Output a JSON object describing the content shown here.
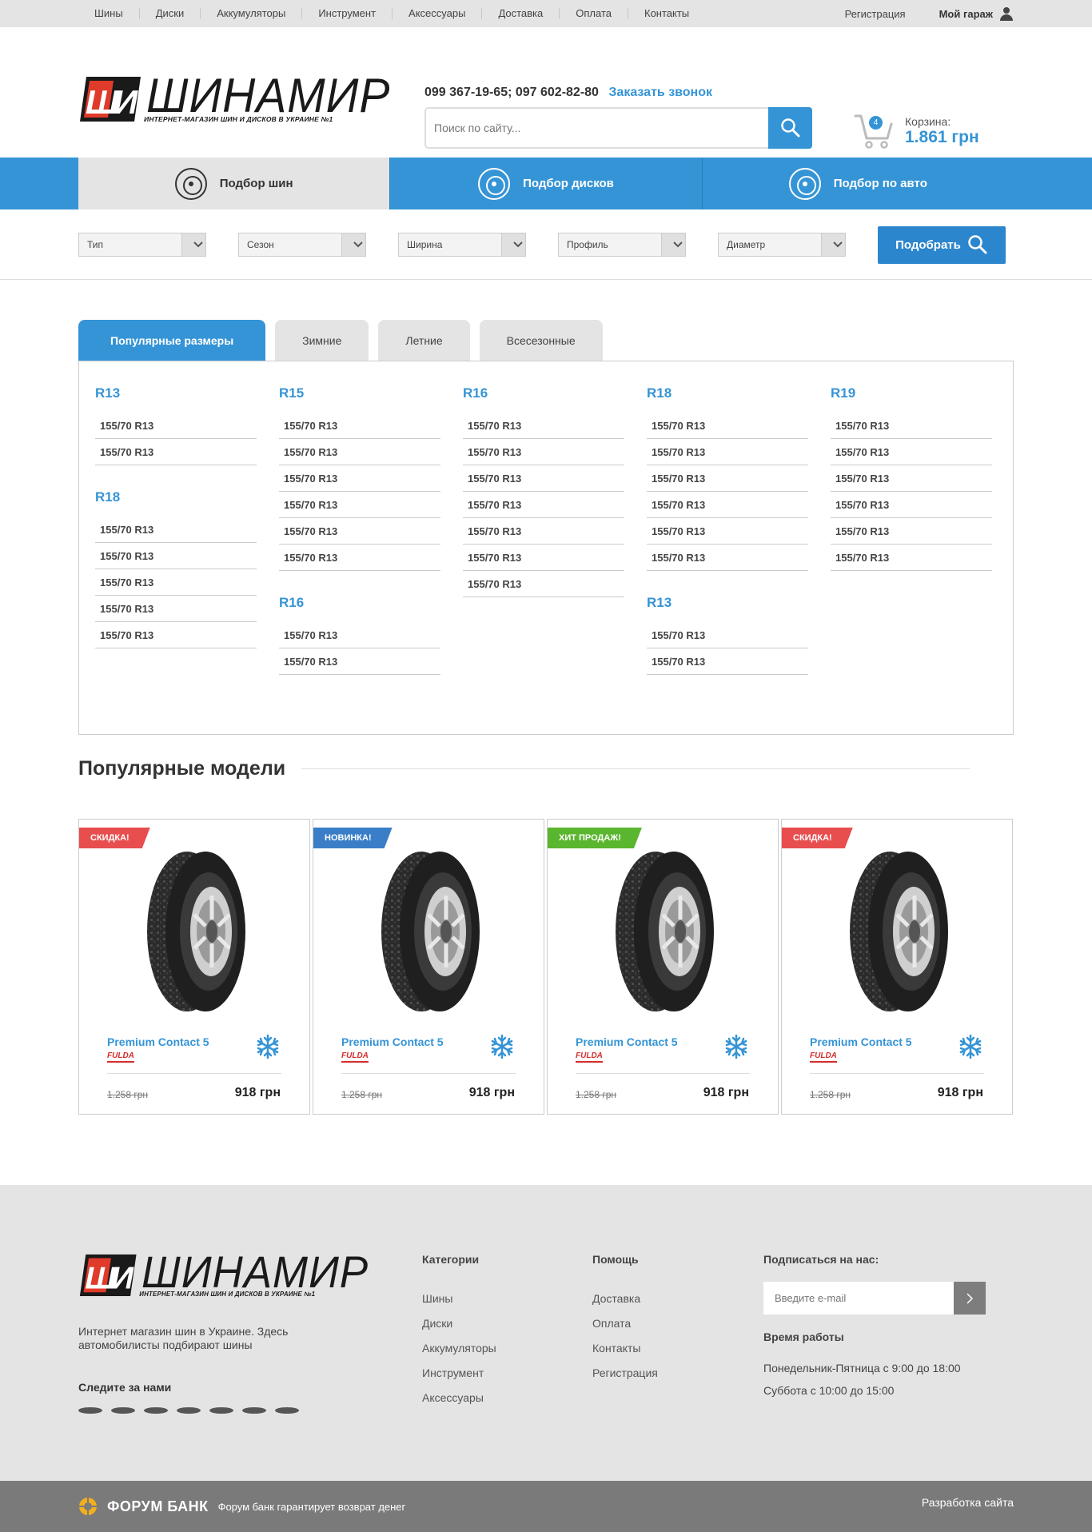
{
  "topbar": {
    "nav": [
      "Шины",
      "Диски",
      "Аккумуляторы",
      "Инструмент",
      "Аксессуары",
      "Доставка",
      "Оплата",
      "Контакты"
    ],
    "register": "Регистрация",
    "garage": "Мой гараж"
  },
  "header": {
    "logo_text": "ШИНАМИР",
    "logo_sub": "ИНТЕРНЕТ-МАГАЗИН ШИН И ДИСКОВ В УКРАИНЕ №1",
    "phones": "099 367-19-65; 097 602-82-80",
    "callback": "Заказать звонок",
    "search_placeholder": "Поиск по сайту...",
    "cart_count": "4",
    "cart_label": "Корзина:",
    "cart_sum": "1.861 грн"
  },
  "mainnav": [
    "Подбор шин",
    "Подбор дисков",
    "Подбор по авто"
  ],
  "filters": {
    "selects": [
      "Тип",
      "Сезон",
      "Ширина",
      "Профиль",
      "Диаметр"
    ],
    "button": "Подобрать"
  },
  "sizes": {
    "tabs": [
      "Популярные размеры",
      "Зимние",
      "Летние",
      "Всесезонные"
    ],
    "columns": [
      [
        {
          "title": "R13",
          "items": [
            "155/70 R13",
            "155/70 R13"
          ]
        },
        {
          "title": "R18",
          "items": [
            "155/70 R13",
            "155/70 R13",
            "155/70 R13",
            "155/70 R13",
            "155/70 R13"
          ]
        }
      ],
      [
        {
          "title": "R15",
          "items": [
            "155/70 R13",
            "155/70 R13",
            "155/70 R13",
            "155/70 R13",
            "155/70 R13",
            "155/70 R13"
          ]
        },
        {
          "title": "R16",
          "items": [
            "155/70 R13",
            "155/70 R13"
          ]
        }
      ],
      [
        {
          "title": "R16",
          "items": [
            "155/70 R13",
            "155/70 R13",
            "155/70 R13",
            "155/70 R13",
            "155/70 R13",
            "155/70 R13",
            "155/70 R13"
          ]
        }
      ],
      [
        {
          "title": "R18",
          "items": [
            "155/70 R13",
            "155/70 R13",
            "155/70 R13",
            "155/70 R13",
            "155/70 R13",
            "155/70 R13"
          ]
        },
        {
          "title": "R13",
          "items": [
            "155/70 R13",
            "155/70 R13"
          ]
        }
      ],
      [
        {
          "title": "R19",
          "items": [
            "155/70 R13",
            "155/70 R13",
            "155/70 R13",
            "155/70 R13",
            "155/70 R13",
            "155/70 R13"
          ]
        }
      ]
    ]
  },
  "models": {
    "title": "Популярные модели",
    "cards": [
      {
        "badge": "СКИДКА!",
        "badge_type": "sale",
        "name": "Premium Contact 5",
        "brand": "FULDA",
        "old": "1.258 грн",
        "price": "918 грн"
      },
      {
        "badge": "НОВИНКА!",
        "badge_type": "new",
        "name": "Premium Contact 5",
        "brand": "FULDA",
        "old": "1.258 грн",
        "price": "918 грн"
      },
      {
        "badge": "ХИТ ПРОДАЖ!",
        "badge_type": "hit",
        "name": "Premium Contact 5",
        "brand": "FULDA",
        "old": "1.258 грн",
        "price": "918 грн"
      },
      {
        "badge": "СКИДКА!",
        "badge_type": "sale",
        "name": "Premium Contact 5",
        "brand": "FULDA",
        "old": "1.258 грн",
        "price": "918 грн"
      }
    ]
  },
  "footer": {
    "desc": "Интернет магазин шин в Украине. Здесь автомобилисты подбирают шины",
    "follow": "Следите за нами",
    "categories_title": "Категории",
    "categories": [
      "Шины",
      "Диски",
      "Аккумуляторы",
      "Инструмент",
      "Аксессуары"
    ],
    "help_title": "Помощь",
    "help": [
      "Доставка",
      "Оплата",
      "Контакты",
      "Регистрация"
    ],
    "subscribe_title": "Подписаться на нас:",
    "email_placeholder": "Введите e-mail",
    "hours_title": "Время работы",
    "hours": [
      "Понедельник-Пятница с 9:00 до 18:00",
      "Суббота с 10:00 до 15:00"
    ]
  },
  "bottom": {
    "bank_name": "ФОРУМ БАНК",
    "bank_text": "Форум банк гарантирует возврат денег",
    "dev": "Разработка сайта"
  }
}
